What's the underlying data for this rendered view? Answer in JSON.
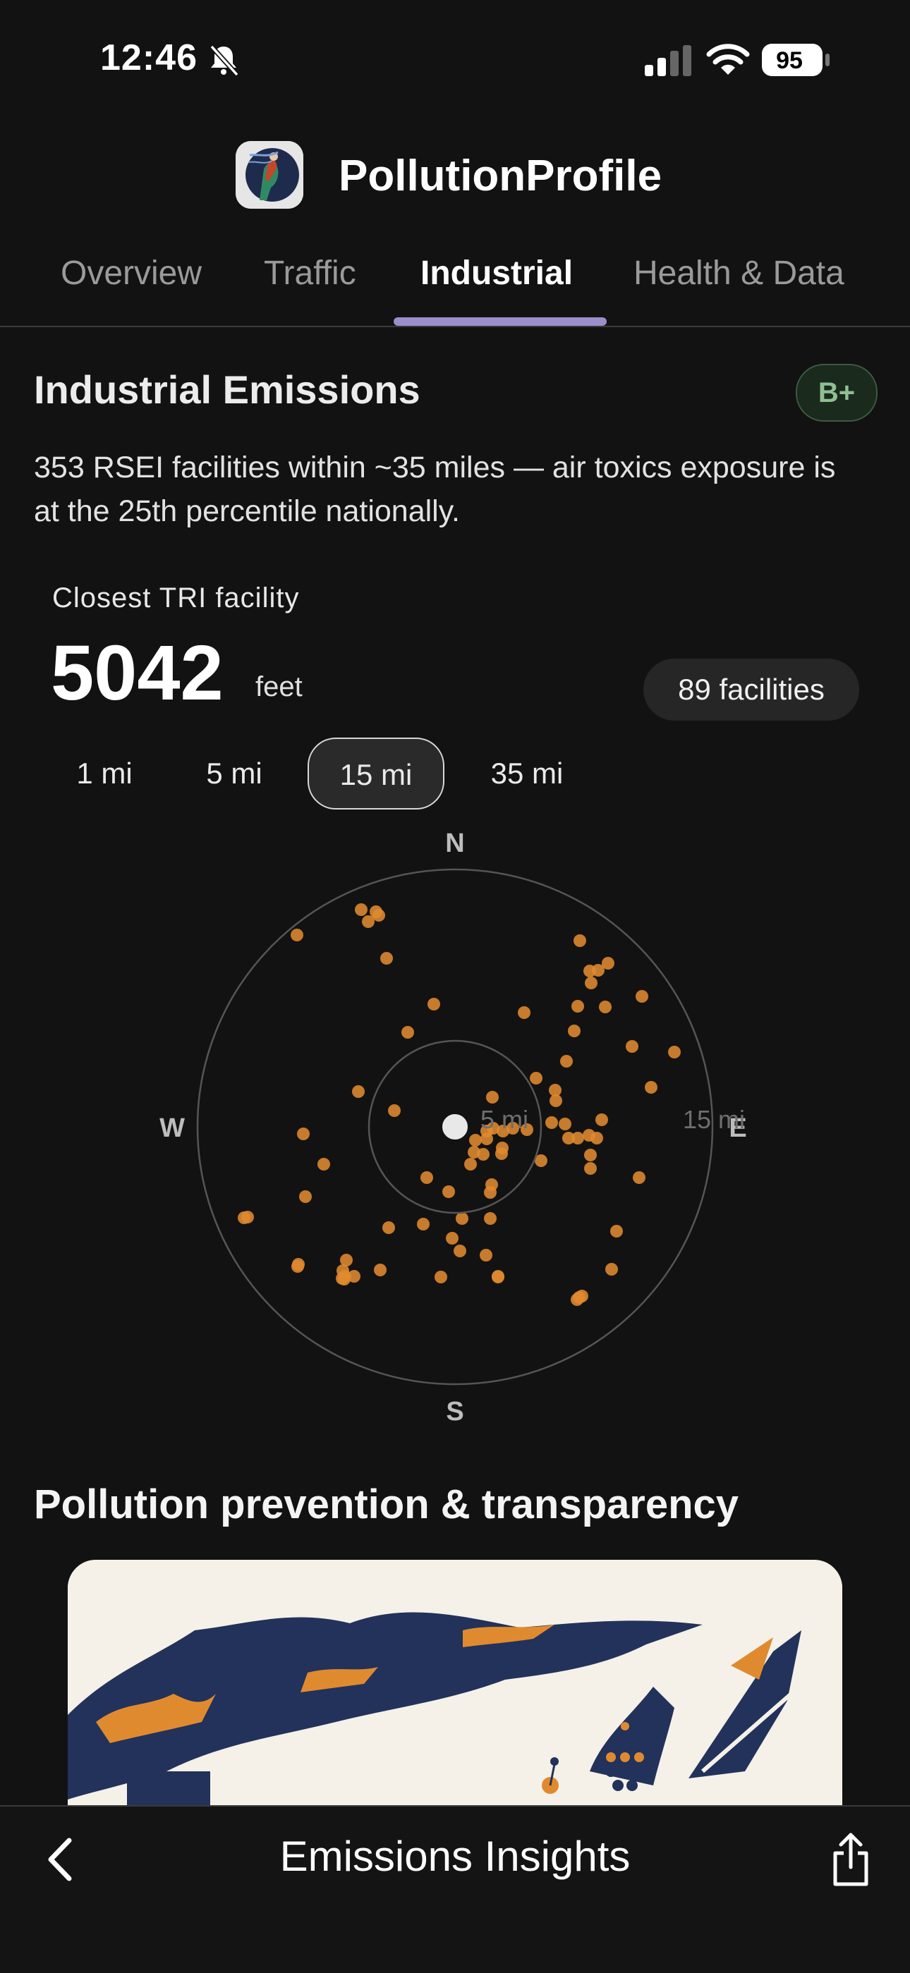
{
  "status_bar": {
    "time": "12:46",
    "battery": "95"
  },
  "app": {
    "title": "PollutionProfile",
    "accent": "#9c8ec9"
  },
  "tabs": [
    {
      "label": "Overview",
      "active": false
    },
    {
      "label": "Traffic",
      "active": false
    },
    {
      "label": "Industrial",
      "active": true
    },
    {
      "label": "Health & Data",
      "active": false
    }
  ],
  "industrial": {
    "title": "Industrial Emissions",
    "grade": "B+",
    "description": "353 RSEI facilities within ~35 miles — air toxics exposure is at the 25th percentile nationally.",
    "closest_label": "Closest TRI facility",
    "closest_value": "5042",
    "closest_unit": "feet",
    "facilities_count": "89 facilities",
    "range_tabs": [
      {
        "label": "1 mi",
        "active": false
      },
      {
        "label": "5 mi",
        "active": false
      },
      {
        "label": "15 mi",
        "active": true
      },
      {
        "label": "35 mi",
        "active": false
      }
    ],
    "compass": {
      "north": "N",
      "south": "S",
      "east": "E",
      "west": "W",
      "ring_labels": [
        "5 mi",
        "15 mi"
      ],
      "dot_color": "#e08a30"
    }
  },
  "section2": {
    "title": "Pollution prevention & transparency"
  },
  "bottom_bar": {
    "title": "Emissions Insights"
  }
}
